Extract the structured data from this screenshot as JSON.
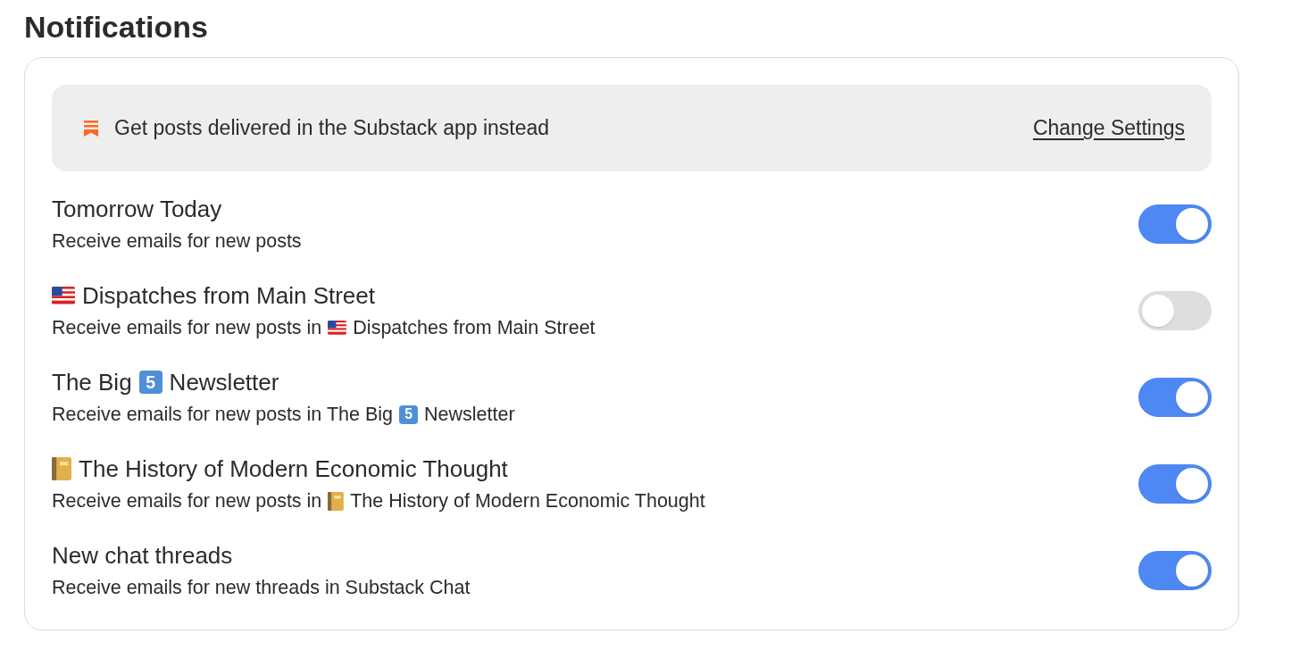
{
  "heading": "Notifications",
  "banner": {
    "text": "Get posts delivered in the Substack app instead",
    "link": "Change Settings"
  },
  "subscriptions": [
    {
      "title": [
        {
          "kind": "text",
          "text": "Tomorrow Today"
        }
      ],
      "description": [
        {
          "kind": "text",
          "text": "Receive emails for new posts"
        }
      ],
      "on": true
    },
    {
      "title": [
        {
          "kind": "flag"
        },
        {
          "kind": "text",
          "text": "Dispatches from Main Street"
        }
      ],
      "description": [
        {
          "kind": "text",
          "text": "Receive emails for new posts in"
        },
        {
          "kind": "flag"
        },
        {
          "kind": "text",
          "text": "Dispatches from Main Street"
        }
      ],
      "on": false
    },
    {
      "title": [
        {
          "kind": "text",
          "text": "The Big"
        },
        {
          "kind": "keycap",
          "text": "5"
        },
        {
          "kind": "text",
          "text": "Newsletter"
        }
      ],
      "description": [
        {
          "kind": "text",
          "text": "Receive emails for new posts in The Big"
        },
        {
          "kind": "keycap",
          "text": "5"
        },
        {
          "kind": "text",
          "text": "Newsletter"
        }
      ],
      "on": true
    },
    {
      "title": [
        {
          "kind": "notebook"
        },
        {
          "kind": "text",
          "text": "The History of Modern Economic Thought"
        }
      ],
      "description": [
        {
          "kind": "text",
          "text": "Receive emails for new posts in"
        },
        {
          "kind": "notebook"
        },
        {
          "kind": "text",
          "text": "The History of Modern Economic Thought"
        }
      ],
      "on": true
    },
    {
      "title": [
        {
          "kind": "text",
          "text": "New chat threads"
        }
      ],
      "description": [
        {
          "kind": "text",
          "text": "Receive emails for new threads in Substack Chat"
        }
      ],
      "on": true
    }
  ]
}
